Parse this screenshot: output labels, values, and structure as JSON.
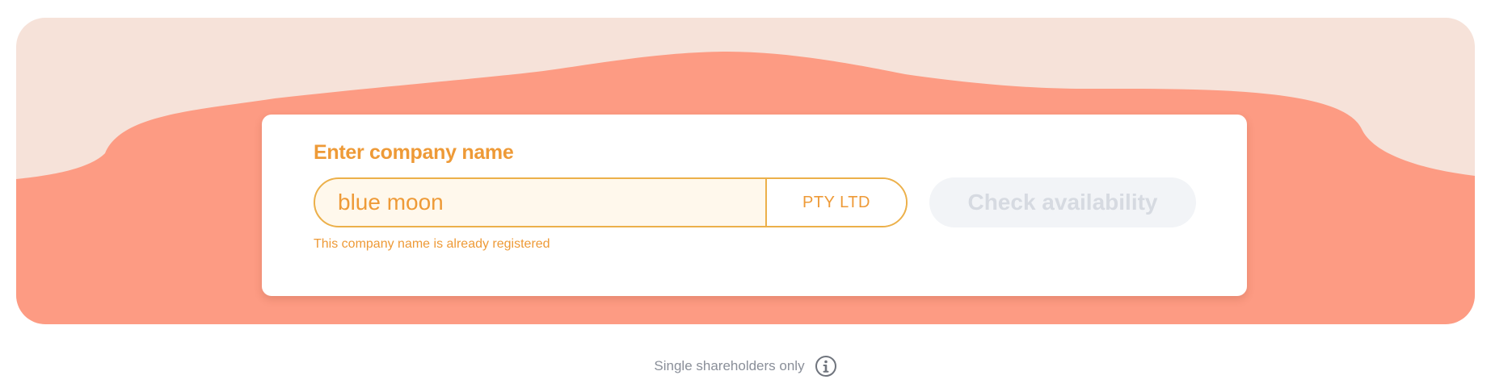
{
  "form": {
    "label": "Enter company name",
    "company_name_value": "blue moon",
    "suffix": "PTY LTD",
    "error_message": "This company name is already registered",
    "check_button_label": "Check availability"
  },
  "footer": {
    "note": "Single shareholders only",
    "info_icon": "info-icon"
  },
  "colors": {
    "hero_background": "#f6e2d9",
    "hero_wave": "#fd9b83",
    "accent": "#ee9a37",
    "field_border": "#ecb04a",
    "field_background": "#fff8ec",
    "button_disabled_bg": "#f2f4f7",
    "button_disabled_text": "#d6dae1",
    "footer_text": "#8a8f99"
  }
}
